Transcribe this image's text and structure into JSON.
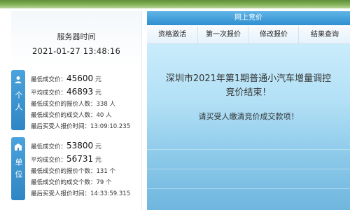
{
  "server": {
    "label": "服务器时间",
    "time": "2021-01-27 13:48:16"
  },
  "personal": {
    "tab_label": "个人",
    "min_price_label": "最低成交价：",
    "min_price_value": "45600",
    "avg_price_label": "平均成交价：",
    "avg_price_value": "46893",
    "price_unit": "元",
    "bidders_label": "最低成交价的报价人数：",
    "bidders_value": "338 人",
    "winners_label": "最低成交价的成交人数：",
    "winners_value": "40 人",
    "last_time_label": "最后买受人报价时间：",
    "last_time_value": "13:09:10.235"
  },
  "company": {
    "tab_label": "单位",
    "min_price_label": "最低成交价：",
    "min_price_value": "53800",
    "avg_price_label": "平均成交价：",
    "avg_price_value": "56731",
    "price_unit": "元",
    "bidders_label": "最低成交价的报价个数：",
    "bidders_value": "131 个",
    "winners_label": "最低成交价的成交个数：",
    "winners_value": "79 个",
    "last_time_label": "最后买受人报价时间：",
    "last_time_value": "14:33:59.315"
  },
  "header": {
    "title": "网上竞价"
  },
  "tabs": [
    {
      "label": "资格激活"
    },
    {
      "label": "第一次报价"
    },
    {
      "label": "修改报价"
    },
    {
      "label": "结果查询"
    }
  ],
  "message": {
    "line1": "深圳市2021年第1期普通小汽车增量调控",
    "line2": "竞价结束！",
    "notice": "请买受人缴清竞价成交款项！"
  },
  "colors": {
    "header_blue": "#2f8fd0",
    "tab_blue": "#4aa3dc",
    "sea_light": "#c9ecfb",
    "sea_dark": "#6fb6de"
  },
  "icons": {
    "personal": "person-icon",
    "company": "company-icon"
  }
}
